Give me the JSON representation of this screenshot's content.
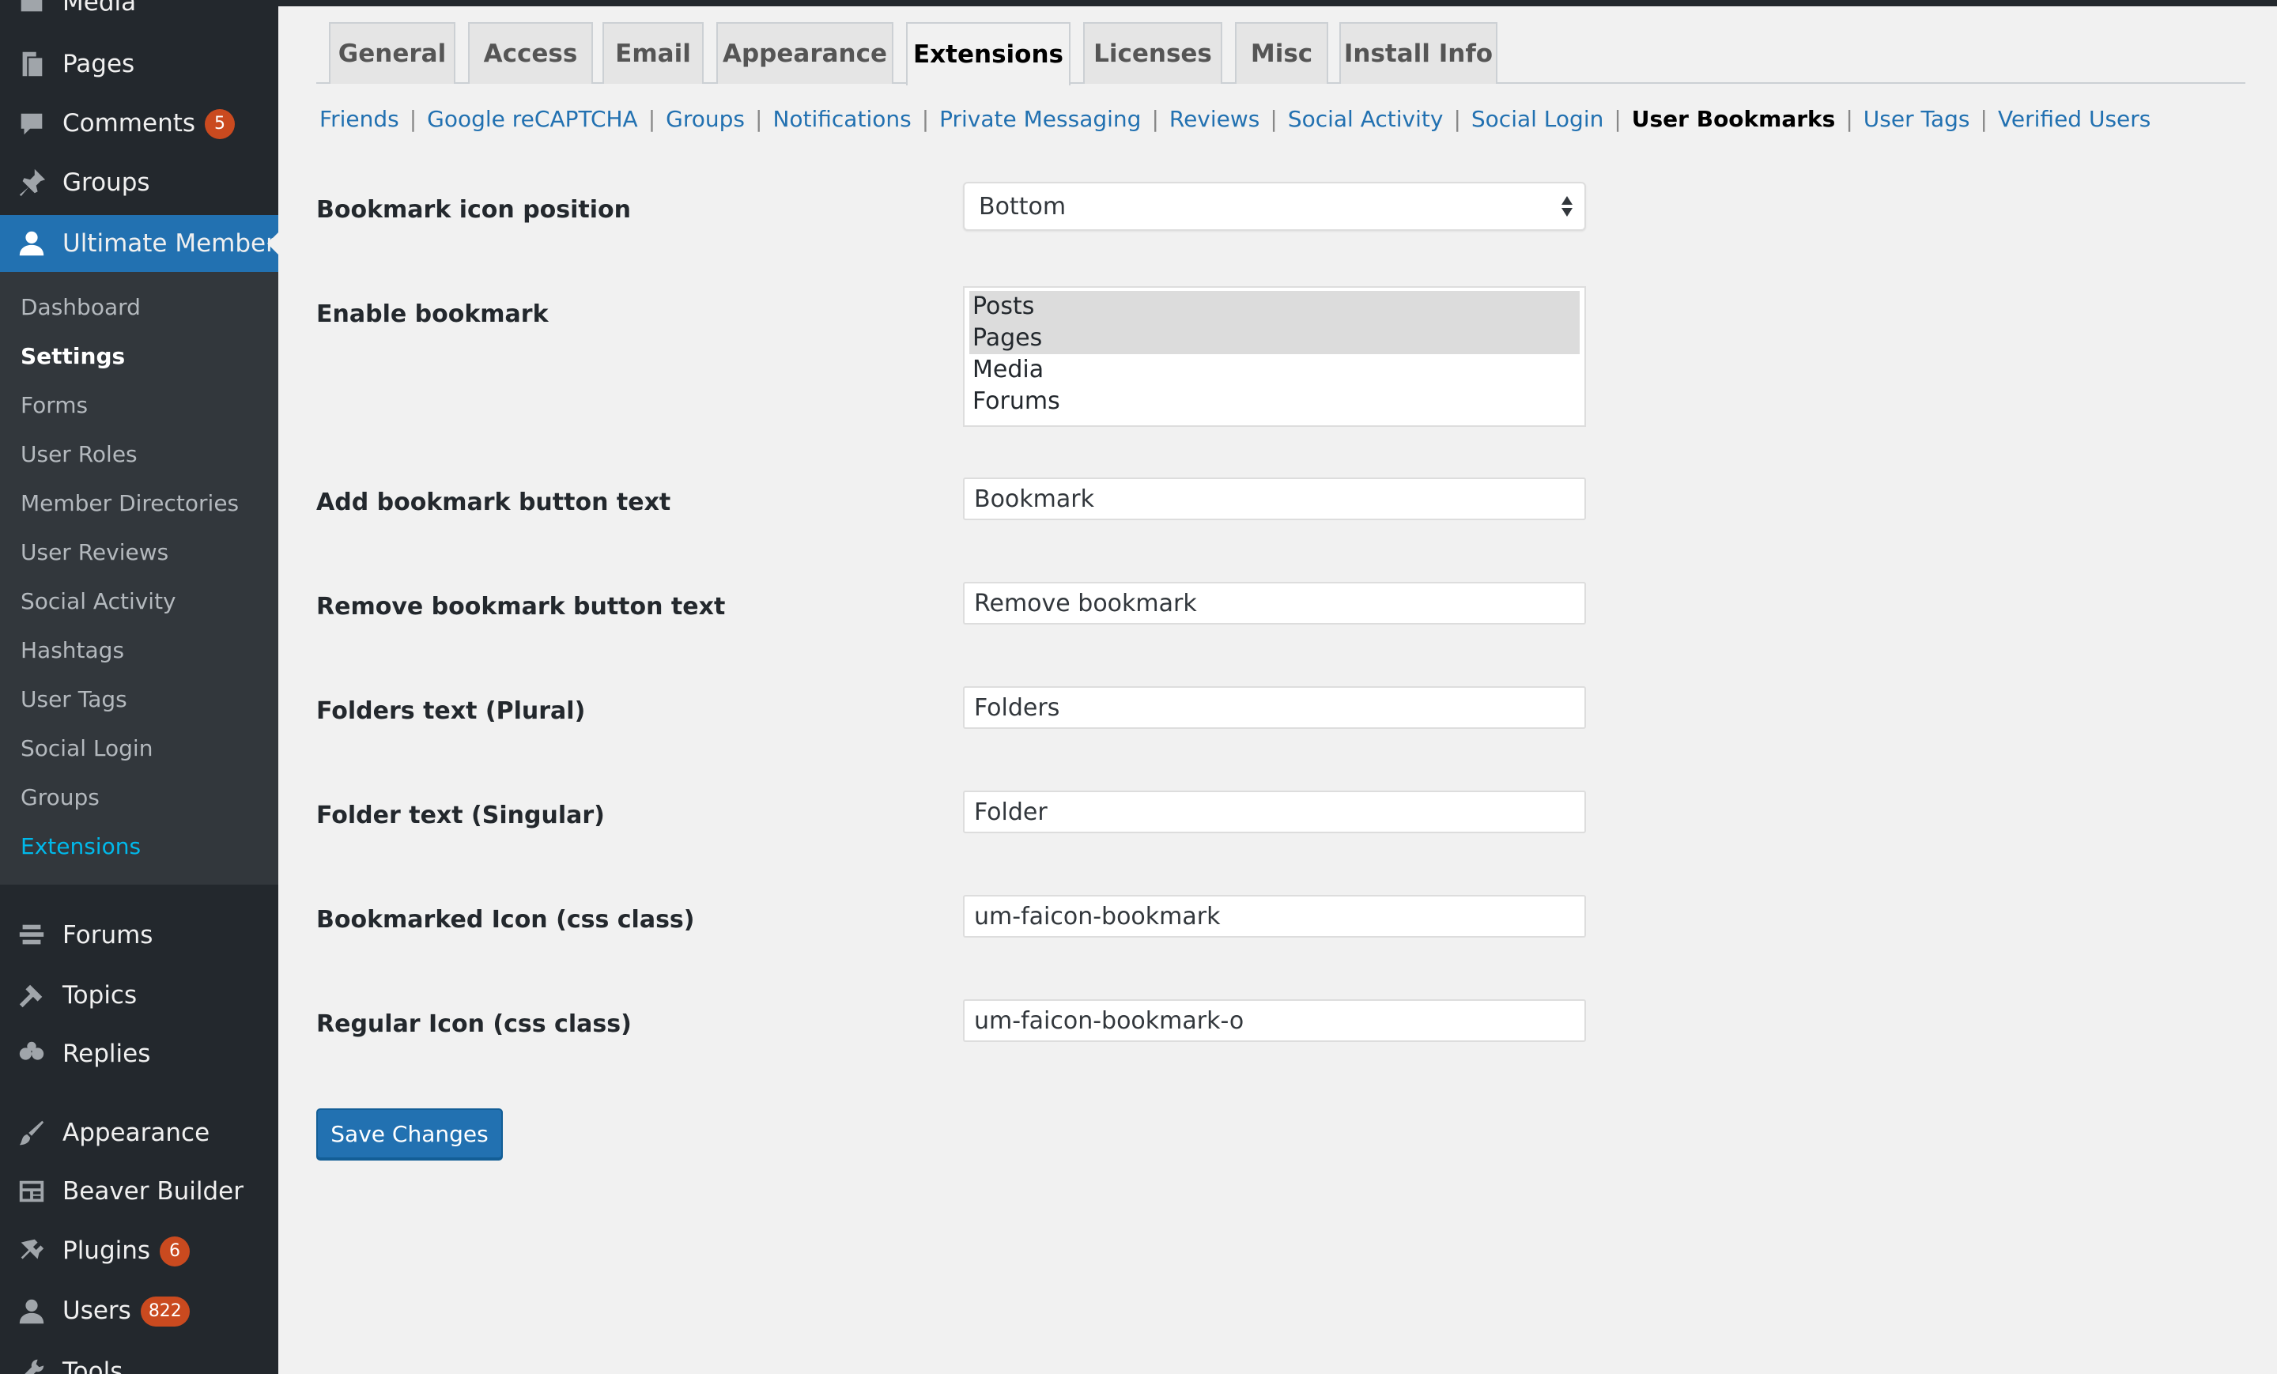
{
  "sidebar": {
    "menu": {
      "media": "Media",
      "pages": "Pages",
      "comments": "Comments",
      "comments_badge": "5",
      "groups": "Groups",
      "ultimate_member": "Ultimate Member",
      "forums": "Forums",
      "topics": "Topics",
      "replies": "Replies",
      "appearance": "Appearance",
      "beaver_builder": "Beaver Builder",
      "plugins": "Plugins",
      "plugins_badge": "6",
      "users": "Users",
      "users_badge": "822",
      "tools": "Tools"
    },
    "submenu": [
      "Dashboard",
      "Settings",
      "Forms",
      "User Roles",
      "Member Directories",
      "User Reviews",
      "Social Activity",
      "Hashtags",
      "User Tags",
      "Social Login",
      "Groups",
      "Extensions"
    ],
    "colors": {
      "background": "#23282d",
      "submenu_bg": "#32373c",
      "active": "#2271b1",
      "badge": "#ca4a1f",
      "current_link": "#00b9eb"
    }
  },
  "tabs": [
    "General",
    "Access",
    "Email",
    "Appearance",
    "Extensions",
    "Licenses",
    "Misc",
    "Install Info"
  ],
  "active_tab": "Extensions",
  "subnav": {
    "links": [
      "Friends",
      "Google reCAPTCHA",
      "Groups",
      "Notifications",
      "Private Messaging",
      "Reviews",
      "Social Activity",
      "Social Login",
      "User Bookmarks",
      "User Tags",
      "Verified Users"
    ],
    "current": "User Bookmarks",
    "separator": "|"
  },
  "settings": {
    "icon_position": {
      "label": "Bookmark icon position",
      "value": "Bottom"
    },
    "enable_bookmark": {
      "label": "Enable bookmark",
      "options": [
        "Posts",
        "Pages",
        "Media",
        "Forums"
      ],
      "selected": [
        "Posts",
        "Pages"
      ]
    },
    "add_text": {
      "label": "Add bookmark button text",
      "value": "Bookmark"
    },
    "remove_text": {
      "label": "Remove bookmark button text",
      "value": "Remove bookmark"
    },
    "folders_plural": {
      "label": "Folders text (Plural)",
      "value": "Folders"
    },
    "folder_singular": {
      "label": "Folder text (Singular)",
      "value": "Folder"
    },
    "bookmarked_icon": {
      "label": "Bookmarked Icon (css class)",
      "value": "um-faicon-bookmark"
    },
    "regular_icon": {
      "label": "Regular Icon (css class)",
      "value": "um-faicon-bookmark-o"
    }
  },
  "save_label": "Save Changes",
  "icons": {
    "media": "media-icon",
    "pages": "pages-icon",
    "comments": "comment-icon",
    "groups": "pin-icon",
    "ultimate_member": "user-icon",
    "forums": "forums-icon",
    "topics": "topics-icon",
    "replies": "replies-icon",
    "appearance": "brush-icon",
    "beaver_builder": "layout-icon",
    "plugins": "plug-icon",
    "users": "users-icon",
    "tools": "wrench-icon"
  }
}
